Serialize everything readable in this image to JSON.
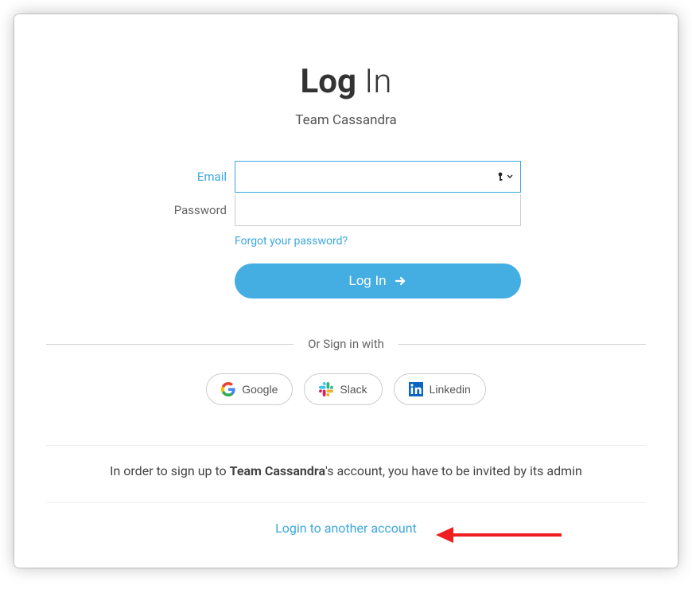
{
  "title": {
    "bold": "Log",
    "light": " In"
  },
  "team_name": "Team Cassandra",
  "labels": {
    "email": "Email",
    "password": "Password"
  },
  "fields": {
    "email_value": "",
    "password_value": ""
  },
  "links": {
    "forgot": "Forgot your password?",
    "another": "Login to another account"
  },
  "buttons": {
    "login": "Log In"
  },
  "divider_text": "Or Sign in with",
  "social": {
    "google": "Google",
    "slack": "Slack",
    "linkedin": "Linkedin"
  },
  "invite_note": {
    "prefix": "In order to sign up to ",
    "team": "Team Cassandra",
    "suffix": "'s account, you have to be invited by its admin"
  }
}
